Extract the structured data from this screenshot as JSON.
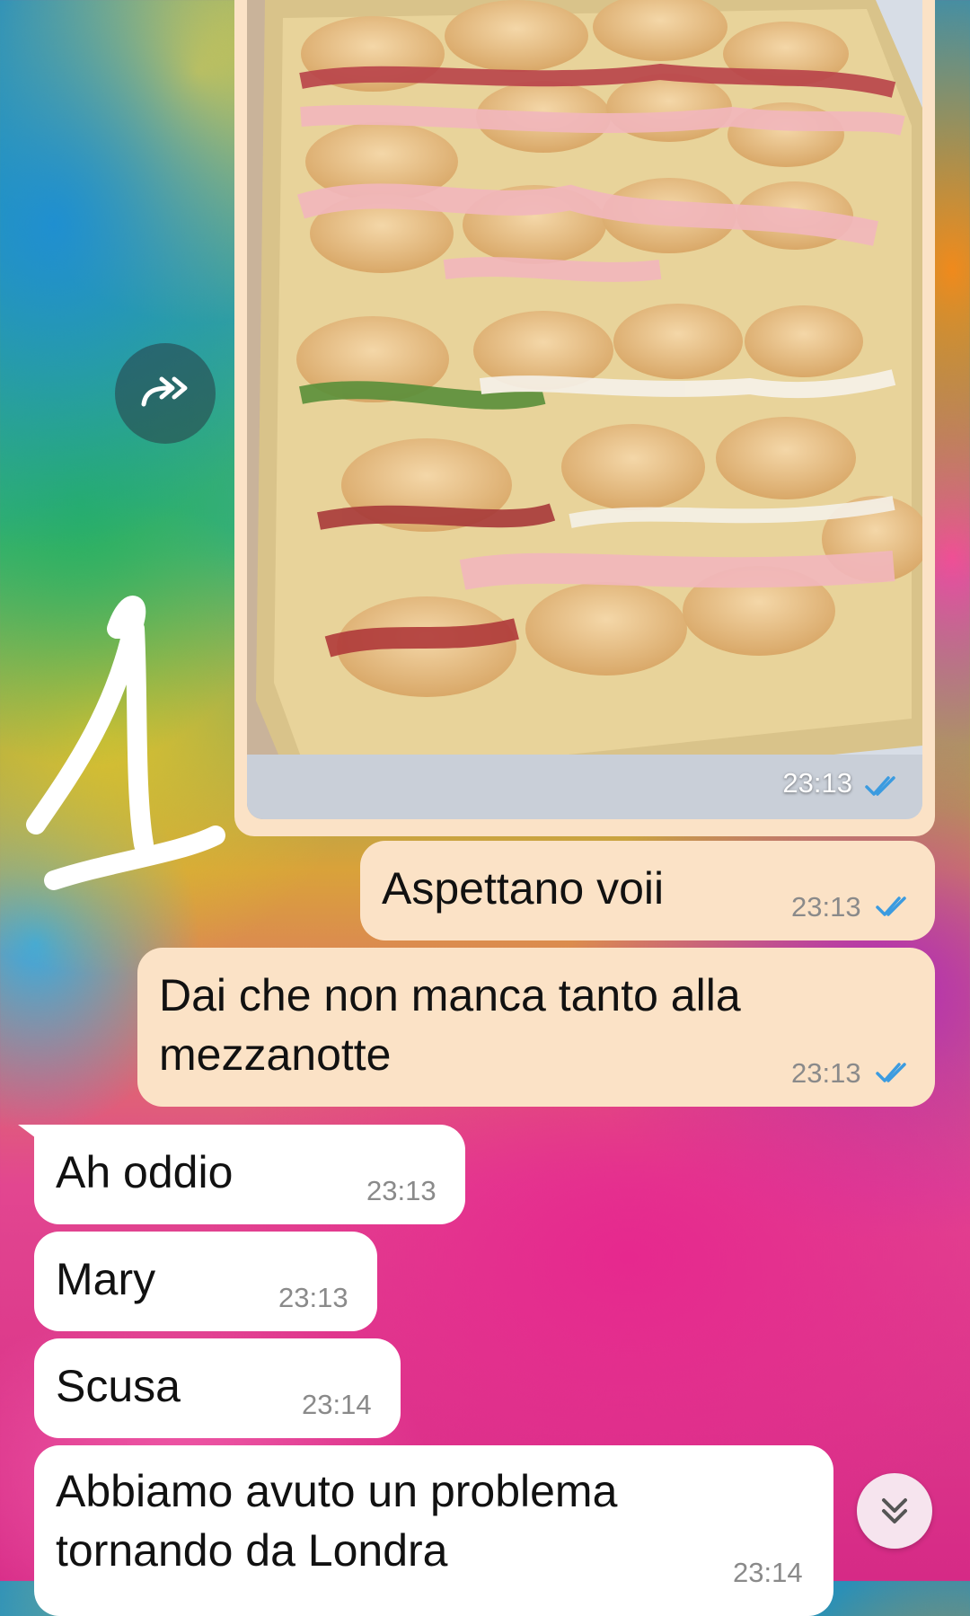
{
  "image_message": {
    "time": "23:13",
    "status": "read",
    "icon": "double-check-icon"
  },
  "messages": [
    {
      "direction": "outgoing",
      "text": "Aspettano voii",
      "time": "23:13",
      "status": "read"
    },
    {
      "direction": "outgoing",
      "text": "Dai che non manca tanto alla\nmezzanotte",
      "time": "23:13",
      "status": "read"
    },
    {
      "direction": "incoming",
      "text": "Ah oddio",
      "time": "23:13"
    },
    {
      "direction": "incoming",
      "text": "Mary",
      "time": "23:13"
    },
    {
      "direction": "incoming",
      "text": "Scusa",
      "time": "23:14"
    },
    {
      "direction": "incoming",
      "text": "Abbiamo avuto un problema\ntornando da Londra",
      "time": "23:14"
    }
  ],
  "controls": {
    "forward_icon": "forward-icon",
    "scroll_down_icon": "chevron-double-down-icon"
  },
  "colors": {
    "outgoing_bubble": "#fbe2c6",
    "incoming_bubble": "#ffffff",
    "read_tick": "#3b9be0"
  }
}
